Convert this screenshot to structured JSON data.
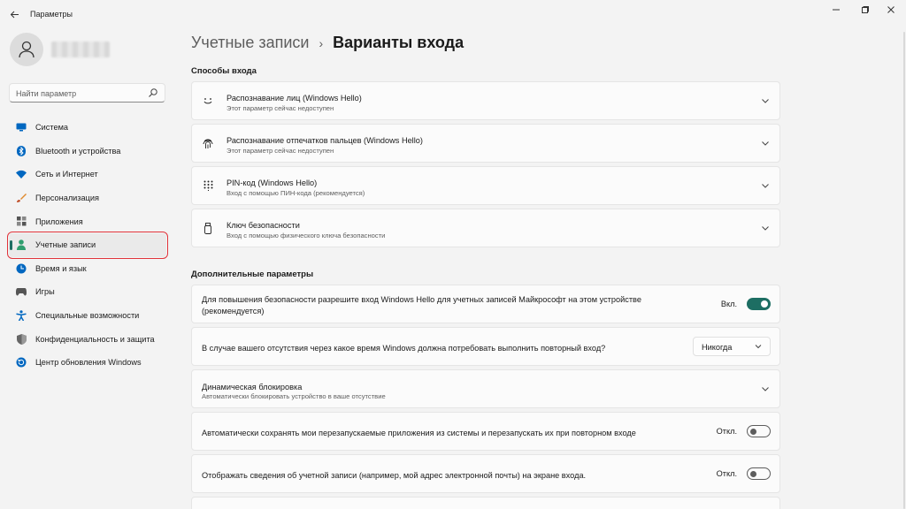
{
  "window": {
    "title": "Параметры",
    "controls": [
      "minimize-icon",
      "restore-icon",
      "close-icon"
    ]
  },
  "sidebar": {
    "search_placeholder": "Найти параметр",
    "items": [
      {
        "label": "Система",
        "icon": "system-icon",
        "color": "#0067c0"
      },
      {
        "label": "Bluetooth и устройства",
        "icon": "bluetooth-icon",
        "color": "#0067c0"
      },
      {
        "label": "Сеть и Интернет",
        "icon": "wifi-icon",
        "color": "#0067c0"
      },
      {
        "label": "Персонализация",
        "icon": "brush-icon",
        "color": "#e08a2e"
      },
      {
        "label": "Приложения",
        "icon": "apps-icon",
        "color": "#555555"
      },
      {
        "label": "Учетные записи",
        "icon": "account-icon",
        "color": "#2f9e6e",
        "active": true
      },
      {
        "label": "Время и язык",
        "icon": "globe-clock-icon",
        "color": "#0067c0"
      },
      {
        "label": "Игры",
        "icon": "gamepad-icon",
        "color": "#555555"
      },
      {
        "label": "Специальные возможности",
        "icon": "accessibility-icon",
        "color": "#0067c0"
      },
      {
        "label": "Конфиденциальность и защита",
        "icon": "shield-icon",
        "color": "#666666"
      },
      {
        "label": "Центр обновления Windows",
        "icon": "update-icon",
        "color": "#0067c0"
      }
    ]
  },
  "header": {
    "parent": "Учетные записи",
    "separator": "›",
    "current": "Варианты входа"
  },
  "sign_in_section": {
    "title": "Способы входа",
    "items": [
      {
        "title": "Распознавание лиц (Windows Hello)",
        "subtitle": "Этот параметр сейчас недоступен",
        "icon": "face-icon"
      },
      {
        "title": "Распознавание отпечатков пальцев (Windows Hello)",
        "subtitle": "Этот параметр сейчас недоступен",
        "icon": "fingerprint-icon"
      },
      {
        "title": "PIN-код (Windows Hello)",
        "subtitle": "Вход с помощью ПИН-кода (рекомендуется)",
        "icon": "pin-keypad-icon"
      },
      {
        "title": "Ключ безопасности",
        "subtitle": "Вход с помощью физического ключа безопасности",
        "icon": "usb-key-icon"
      }
    ]
  },
  "additional_section": {
    "title": "Дополнительные параметры",
    "hello_only": {
      "text_line1": "Для повышения безопасности разрешите вход Windows Hello для учетных записей Майкрософт на этом устройстве",
      "text_line2": "(рекомендуется)",
      "state_label": "Вкл.",
      "state": "on"
    },
    "require_signin": {
      "text": "В случае вашего отсутствия через какое время Windows должна потребовать выполнить повторный вход?",
      "selected": "Никогда"
    },
    "dynamic_lock": {
      "title": "Динамическая блокировка",
      "subtitle": "Автоматически блокировать устройство в ваше отсутствие"
    },
    "restart_apps": {
      "text": "Автоматически сохранять мои перезапускаемые приложения из системы и перезапускать их при повторном входе",
      "state_label": "Откл.",
      "state": "off"
    },
    "show_account": {
      "text": "Отображать сведения об учетной записи (например, мой адрес электронной почты) на экране входа.",
      "state_label": "Откл.",
      "state": "off"
    }
  },
  "colors": {
    "accent": "#1d6e63",
    "highlight_border": "#e0333a"
  }
}
